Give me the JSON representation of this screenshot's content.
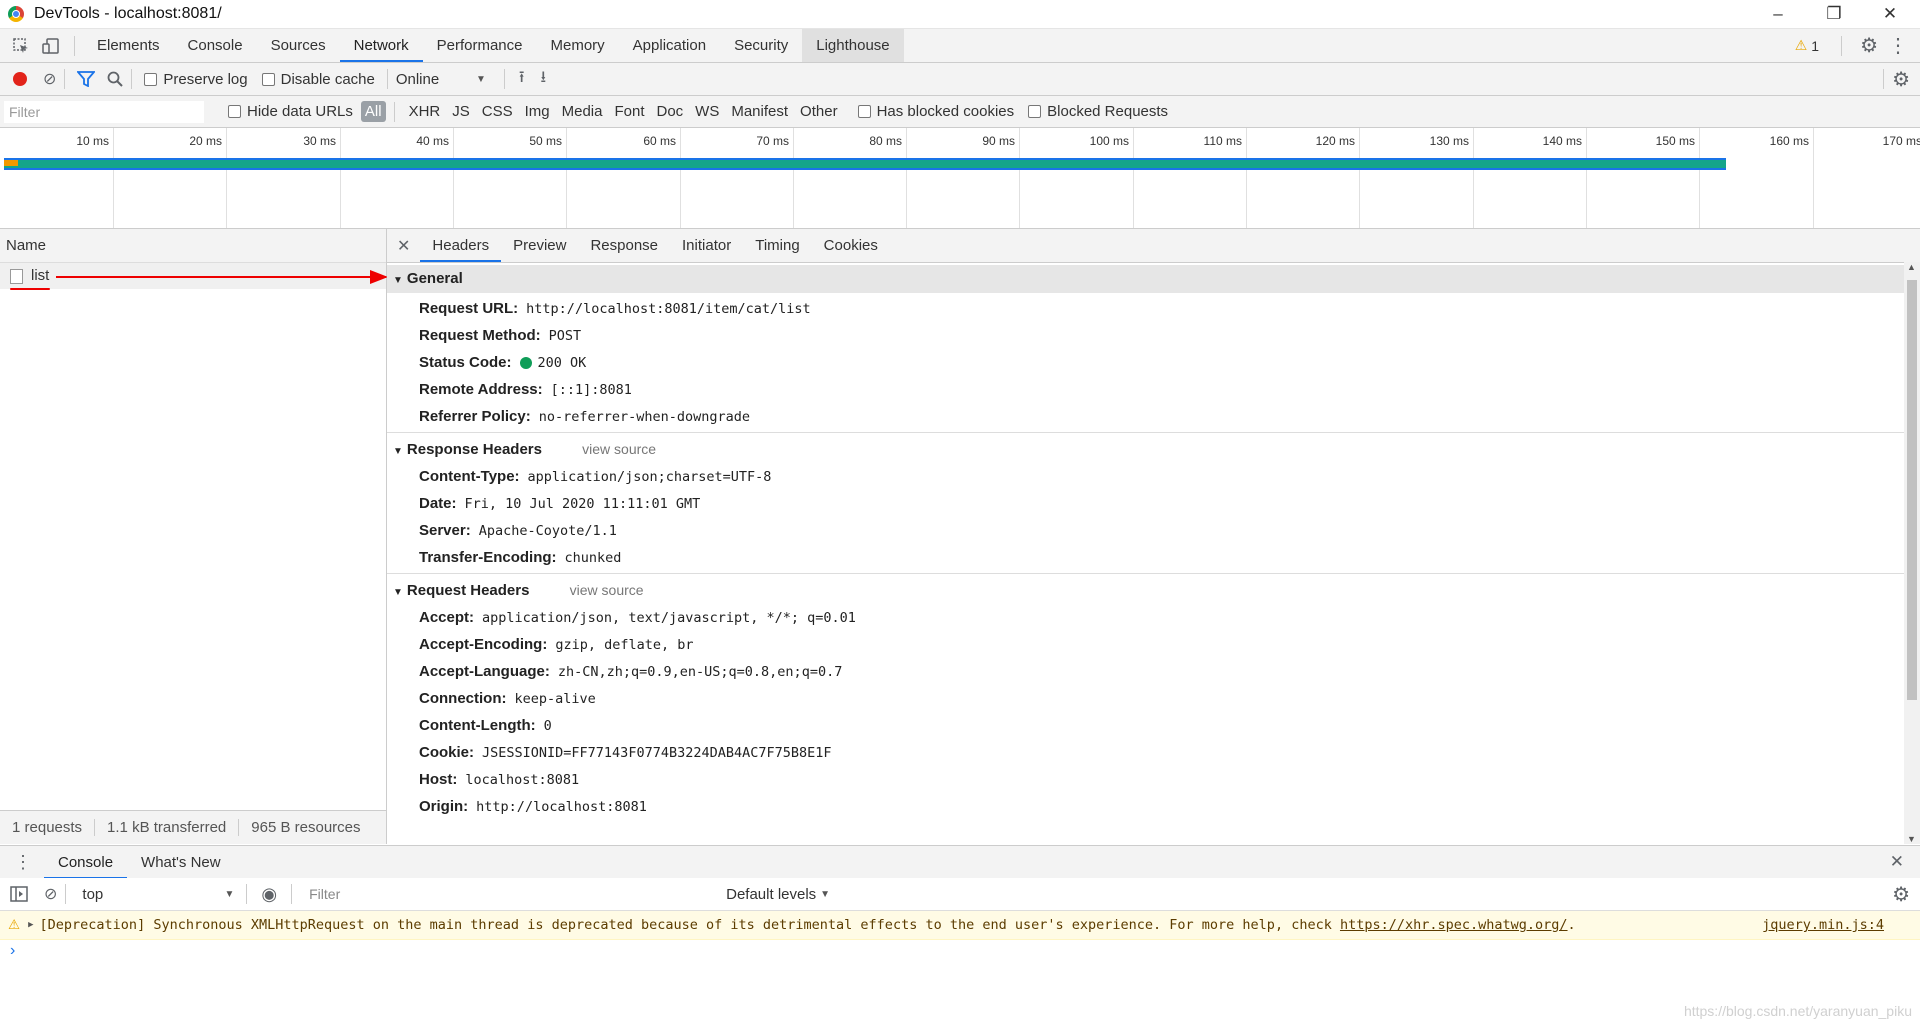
{
  "window": {
    "title": "DevTools - localhost:8081/"
  },
  "main_tabs": [
    "Elements",
    "Console",
    "Sources",
    "Network",
    "Performance",
    "Memory",
    "Application",
    "Security",
    "Lighthouse"
  ],
  "warnings_count": "1",
  "network_toolbar": {
    "preserve_log": "Preserve log",
    "disable_cache": "Disable cache",
    "throttle": "Online"
  },
  "filter_bar": {
    "placeholder": "Filter",
    "hide_data_urls": "Hide data URLs",
    "types": [
      "All",
      "XHR",
      "JS",
      "CSS",
      "Img",
      "Media",
      "Font",
      "Doc",
      "WS",
      "Manifest",
      "Other"
    ],
    "has_blocked_cookies": "Has blocked cookies",
    "blocked_requests": "Blocked Requests"
  },
  "overview": {
    "ticks": [
      "10 ms",
      "20 ms",
      "30 ms",
      "40 ms",
      "50 ms",
      "60 ms",
      "70 ms",
      "80 ms",
      "90 ms",
      "100 ms",
      "110 ms",
      "120 ms",
      "130 ms",
      "140 ms",
      "150 ms",
      "160 ms",
      "170 ms"
    ]
  },
  "request_list": {
    "header": "Name",
    "items": [
      "list"
    ],
    "footer": {
      "requests": "1 requests",
      "transferred": "1.1 kB transferred",
      "resources": "965 B resources"
    }
  },
  "detail_tabs": [
    "Headers",
    "Preview",
    "Response",
    "Initiator",
    "Timing",
    "Cookies"
  ],
  "general": {
    "title": "General",
    "rows": [
      {
        "k": "Request URL:",
        "v": "http://localhost:8081/item/cat/list"
      },
      {
        "k": "Request Method:",
        "v": "POST"
      },
      {
        "k": "Status Code:",
        "v": "200 OK"
      },
      {
        "k": "Remote Address:",
        "v": "[::1]:8081"
      },
      {
        "k": "Referrer Policy:",
        "v": "no-referrer-when-downgrade"
      }
    ]
  },
  "response_headers": {
    "title": "Response Headers",
    "view_source": "view source",
    "rows": [
      {
        "k": "Content-Type:",
        "v": "application/json;charset=UTF-8"
      },
      {
        "k": "Date:",
        "v": "Fri, 10 Jul 2020 11:11:01 GMT"
      },
      {
        "k": "Server:",
        "v": "Apache-Coyote/1.1"
      },
      {
        "k": "Transfer-Encoding:",
        "v": "chunked"
      }
    ]
  },
  "request_headers": {
    "title": "Request Headers",
    "view_source": "view source",
    "rows": [
      {
        "k": "Accept:",
        "v": "application/json, text/javascript, */*; q=0.01"
      },
      {
        "k": "Accept-Encoding:",
        "v": "gzip, deflate, br"
      },
      {
        "k": "Accept-Language:",
        "v": "zh-CN,zh;q=0.9,en-US;q=0.8,en;q=0.7"
      },
      {
        "k": "Connection:",
        "v": "keep-alive"
      },
      {
        "k": "Content-Length:",
        "v": "0"
      },
      {
        "k": "Cookie:",
        "v": "JSESSIONID=FF77143F0774B3224DAB4AC7F75B8E1F"
      },
      {
        "k": "Host:",
        "v": "localhost:8081"
      },
      {
        "k": "Origin:",
        "v": "http://localhost:8081"
      }
    ]
  },
  "drawer": {
    "tabs": [
      "Console",
      "What's New"
    ],
    "context": "top",
    "filter_placeholder": "Filter",
    "levels": "Default levels"
  },
  "console_message": {
    "text": "[Deprecation] Synchronous XMLHttpRequest on the main thread is deprecated because of its detrimental effects to the end user's experience. For more help, check ",
    "link": "https://xhr.spec.whatwg.org/",
    "suffix": ".",
    "source": "jquery.min.js:4"
  },
  "watermark": "https://blog.csdn.net/yaranyuan_piku"
}
